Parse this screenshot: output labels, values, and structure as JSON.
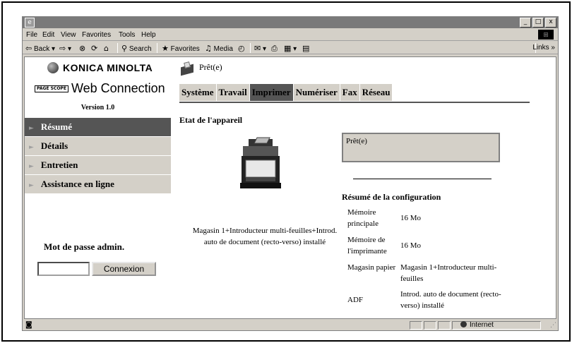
{
  "browser": {
    "menu": [
      "File",
      "Edit",
      "View",
      "Favorites",
      "Tools",
      "Help"
    ],
    "toolbar": {
      "back": "Back",
      "search": "Search",
      "favorites": "Favorites",
      "media": "Media",
      "links": "Links »"
    },
    "window_controls": [
      "_",
      "□",
      "x"
    ],
    "status_zone": "Internet"
  },
  "sidebar": {
    "brand": "KONICA MINOLTA",
    "pagescope_badge": "PAGE SCOPE",
    "product": "Web Connection",
    "version": "Version 1.0",
    "nav": [
      {
        "label": "Résumé",
        "active": true
      },
      {
        "label": "Détails",
        "active": false
      },
      {
        "label": "Entretien",
        "active": false
      },
      {
        "label": "Assistance en ligne",
        "active": false
      }
    ],
    "password_label": "Mot de passe admin.",
    "password_value": "",
    "login_button": "Connexion"
  },
  "main": {
    "status_text": "Prêt(e)",
    "tabs": [
      {
        "label": "Système",
        "active": false
      },
      {
        "label": "Travail",
        "active": false
      },
      {
        "label": "Imprimer",
        "active": true
      },
      {
        "label": "Numériser",
        "active": false
      },
      {
        "label": "Fax",
        "active": false
      },
      {
        "label": "Réseau",
        "active": false
      }
    ],
    "section_title": "Etat de l'appareil",
    "device_description": "Magasin 1+Introducteur multi-feuilles+Introd. auto de document (recto-verso) installé",
    "status_box": "Prêt(e)",
    "config_title": "Résumé de la configuration",
    "config_rows": [
      {
        "label": "Mémoire principale",
        "value": "16 Mo"
      },
      {
        "label": "Mémoire de l'imprimante",
        "value": "16 Mo"
      },
      {
        "label": "Magasin papier",
        "value": "Magasin 1+Introducteur multi-feuilles"
      },
      {
        "label": "ADF",
        "value": "Introd. auto de document (recto-verso) installé"
      }
    ]
  },
  "colors": {
    "active_nav": "#555555",
    "inactive_nav": "#d4d0c8",
    "chrome": "#d4d0c8"
  }
}
